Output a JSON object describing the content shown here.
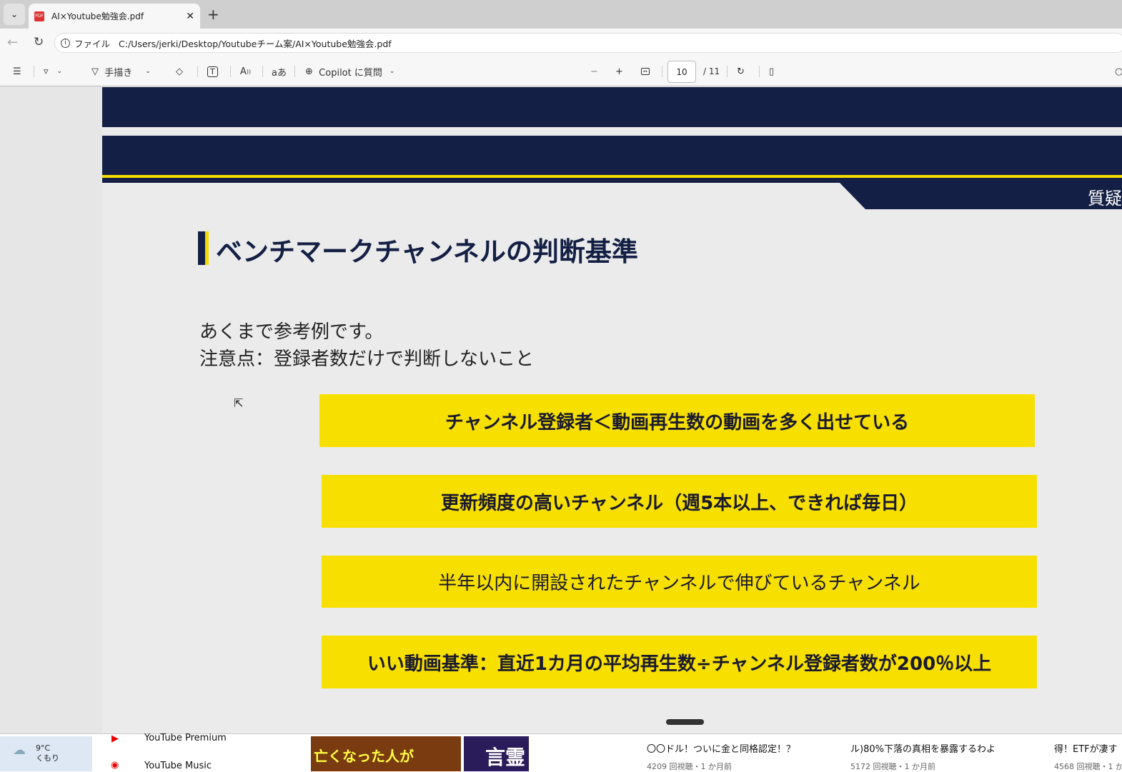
{
  "browser": {
    "tab_title": "AI×Youtube勉強会.pdf",
    "url_label": "ファイル",
    "url": "C:/Users/jerki/Desktop/Youtubeチーム案/AI×Youtube勉強会.pdf"
  },
  "toolbar": {
    "draw_label": "手描き",
    "copilot_label": "Copilot に質問",
    "page_current": "10",
    "page_total": "/ 11"
  },
  "slide": {
    "header_tag": "質疑",
    "title": "ベンチマークチャンネルの判断基準",
    "lines": [
      "あくまで参考例です。",
      "注意点：登録者数だけで判断しないこと"
    ],
    "criteria": [
      "チャンネル登録者＜動画再生数の動画を多く出せている",
      "更新頻度の高いチャンネル（週5本以上、できれば毎日）",
      "半年以内に開設されたチャンネルで伸びているチャンネル",
      "いい動画基準：直近1カ月の平均再生数÷チャンネル登録者数が200％以上"
    ]
  },
  "colors": {
    "navy": "#131f44",
    "yellow": "#f7df00"
  },
  "background": {
    "weather_temp": "9°C",
    "weather_desc": "くもり",
    "sidebar": [
      "YouTube Premium",
      "YouTube Music"
    ],
    "thumbs": [
      "亡くなった人が",
      "言霊"
    ],
    "videos": [
      {
        "title": "〇〇ドル！ついに金と同格認定！？",
        "meta": "4209 回視聴・1 か月前"
      },
      {
        "title": "ル)80%下落の真相を暴露するわよ",
        "meta": "5172 回視聴・1 か月前"
      },
      {
        "title": "得！ETFが凄す",
        "meta": "4568 回視聴・1 か"
      }
    ]
  }
}
